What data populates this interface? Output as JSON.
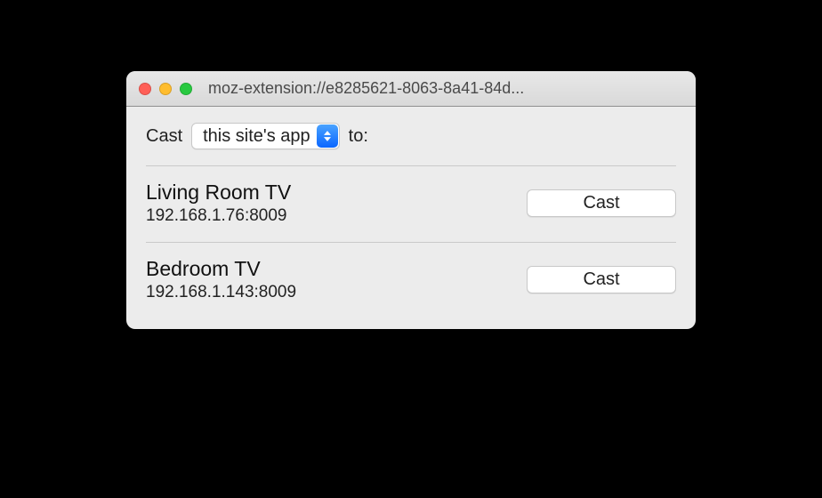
{
  "window": {
    "title": "moz-extension://e8285621-8063-8a41-84d..."
  },
  "castRow": {
    "prefix": "Cast",
    "selected": "this site's app",
    "suffix": "to:"
  },
  "devices": [
    {
      "name": "Living Room TV",
      "address": "192.168.1.76:8009",
      "button": "Cast"
    },
    {
      "name": "Bedroom TV",
      "address": "192.168.1.143:8009",
      "button": "Cast"
    }
  ]
}
